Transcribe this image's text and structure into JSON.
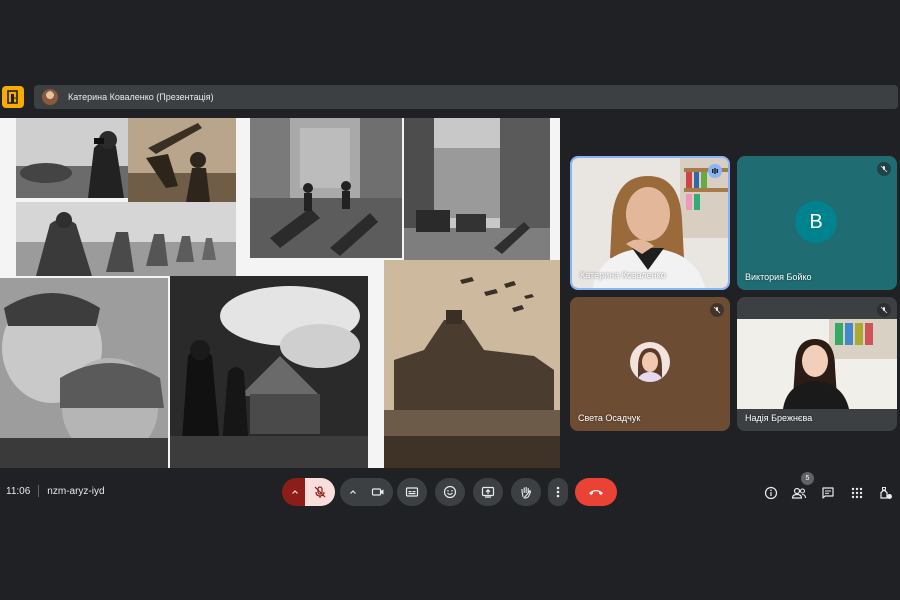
{
  "presenting_bar": {
    "text": "Катерина Коваленко (Презентація)"
  },
  "participants": [
    {
      "name": "Катерина Коваленко",
      "speaking": true
    },
    {
      "name": "Виктория Бойко",
      "initial": "В",
      "muted": true,
      "avatar_color": "#00838f"
    },
    {
      "name": "Света Осадчук",
      "muted": true
    },
    {
      "name": "Надія Брежнєва",
      "muted": true
    }
  ],
  "meeting": {
    "time": "11:06",
    "code": "nzm-aryz-iyd"
  },
  "people_count": "5",
  "icons": {
    "app": "google-meet-door-icon",
    "mic": "mic-off-icon",
    "camera": "videocam-icon",
    "captions": "closed-captions-icon",
    "emoji": "emoji-icon",
    "present": "present-screen-icon",
    "hand": "raise-hand-icon",
    "more": "more-vertical-icon",
    "end": "call-end-icon",
    "info": "info-icon",
    "people": "people-icon",
    "chat": "chat-icon",
    "activities": "apps-grid-icon",
    "host": "host-controls-icon"
  },
  "colors": {
    "end_call": "#ea4335",
    "mic_off_bg": "#f9dedc",
    "accent": "#8ab4f8",
    "logo": "#f9ab00"
  }
}
